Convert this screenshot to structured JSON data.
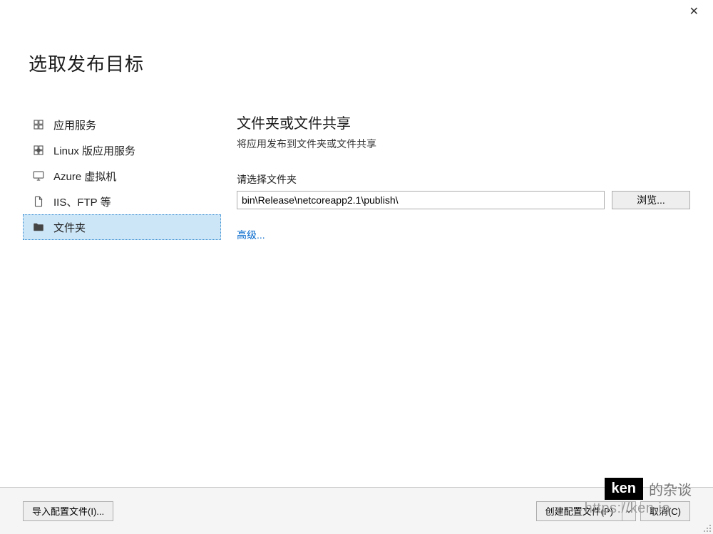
{
  "title": "选取发布目标",
  "sidebar": {
    "items": [
      {
        "label": "应用服务"
      },
      {
        "label": "Linux 版应用服务"
      },
      {
        "label": "Azure 虚拟机"
      },
      {
        "label": "IIS、FTP 等"
      },
      {
        "label": "文件夹"
      }
    ]
  },
  "main": {
    "heading": "文件夹或文件共享",
    "subheading": "将应用发布到文件夹或文件共享",
    "field_label": "请选择文件夹",
    "path_value": "bin\\Release\\netcoreapp2.1\\publish\\",
    "browse_label": "浏览...",
    "advanced_label": "高级..."
  },
  "footer": {
    "import_profile_label": "导入配置文件(I)...",
    "create_profile_label": "创建配置文件(P)",
    "cancel_label": "取消(C)"
  },
  "watermark": {
    "ken": "ken",
    "tag": "的杂谈",
    "url": "https://ken.io"
  }
}
